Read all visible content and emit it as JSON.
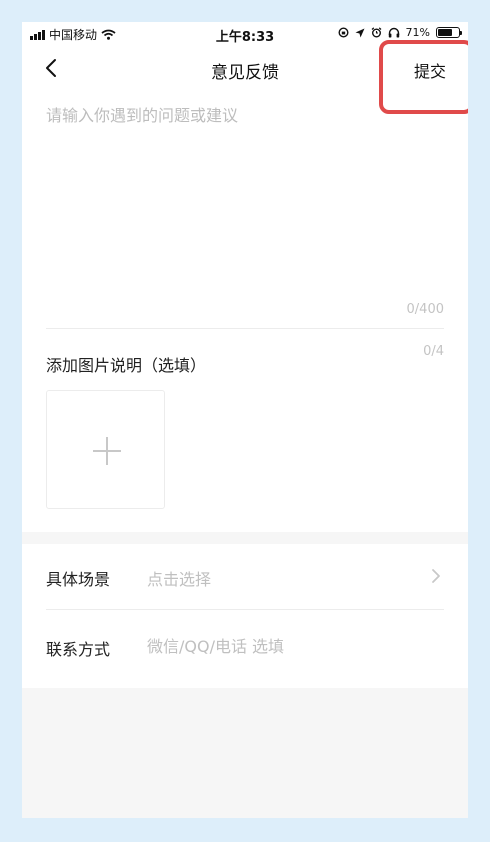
{
  "status_bar": {
    "carrier": "中国移动",
    "time": "上午8:33",
    "battery_percent": "71%",
    "battery_level": 0.71,
    "icons": [
      "signal-icon",
      "wifi-icon",
      "rotation-lock-icon",
      "location-icon",
      "alarm-icon",
      "headphones-icon",
      "battery-icon"
    ]
  },
  "navbar": {
    "back_icon": "chevron-left-icon",
    "title": "意见反馈",
    "submit_label": "提交"
  },
  "feedback": {
    "placeholder": "请输入你遇到的问题或建议",
    "value": "",
    "counter": "0/400"
  },
  "images": {
    "label": "添加图片说明（选填）",
    "counter": "0/4",
    "add_icon": "plus-icon"
  },
  "fields": {
    "scene": {
      "label": "具体场景",
      "value": "点击选择",
      "icon": "chevron-right-icon"
    },
    "contact": {
      "label": "联系方式",
      "placeholder": "微信/QQ/电话 选填"
    }
  },
  "colors": {
    "highlight": "#e04a4a",
    "background": "#ddeefa",
    "placeholder": "#bdbdbd"
  }
}
